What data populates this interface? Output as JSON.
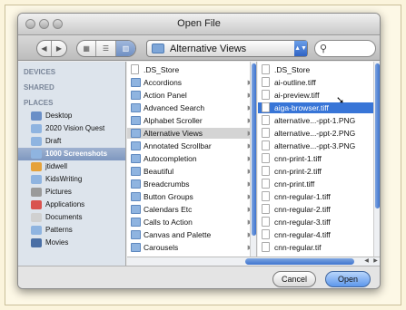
{
  "window": {
    "title": "Open File"
  },
  "toolbar": {
    "back_icon": "back-arrow-icon",
    "forward_icon": "forward-arrow-icon",
    "path_popup": "Alternative Views",
    "search_placeholder": ""
  },
  "sidebar": {
    "devices": "DEVICES",
    "shared": "SHARED",
    "places": "PLACES",
    "items": [
      {
        "label": "Desktop",
        "color": "#6a8fc7"
      },
      {
        "label": "2020 Vision Quest",
        "color": "#8fb4e0"
      },
      {
        "label": "Draft",
        "color": "#8fb4e0"
      },
      {
        "label": "1000 Screenshots",
        "color": "#8fb4e0"
      },
      {
        "label": "jtidwell",
        "color": "#e6a23a"
      },
      {
        "label": "KidsWriting",
        "color": "#8fb4e0"
      },
      {
        "label": "Pictures",
        "color": "#9a9a9a"
      },
      {
        "label": "Applications",
        "color": "#d9534f"
      },
      {
        "label": "Documents",
        "color": "#d0d0d0"
      },
      {
        "label": "Patterns",
        "color": "#8fb4e0"
      },
      {
        "label": "Movies",
        "color": "#4a6fa5"
      }
    ],
    "selected_index": 3
  },
  "column1": {
    "rows": [
      {
        "label": ".DS_Store",
        "type": "doc"
      },
      {
        "label": "Accordions",
        "type": "folder"
      },
      {
        "label": "Action Panel",
        "type": "folder"
      },
      {
        "label": "Advanced Search",
        "type": "folder"
      },
      {
        "label": "Alphabet Scroller",
        "type": "folder"
      },
      {
        "label": "Alternative Views",
        "type": "folder"
      },
      {
        "label": "Annotated Scrollbar",
        "type": "folder"
      },
      {
        "label": "Autocompletion",
        "type": "folder"
      },
      {
        "label": "Beautiful",
        "type": "folder"
      },
      {
        "label": "Breadcrumbs",
        "type": "folder"
      },
      {
        "label": "Button Groups",
        "type": "folder"
      },
      {
        "label": "Calendars Etc",
        "type": "folder"
      },
      {
        "label": "Calls to Action",
        "type": "folder"
      },
      {
        "label": "Canvas and Palette",
        "type": "folder"
      },
      {
        "label": "Carousels",
        "type": "folder"
      }
    ],
    "selected_index": 5
  },
  "column2": {
    "rows": [
      {
        "label": ".DS_Store"
      },
      {
        "label": "ai-outline.tiff"
      },
      {
        "label": "ai-preview.tiff"
      },
      {
        "label": "aiga-browser.tiff"
      },
      {
        "label": "alternative...-ppt-1.PNG"
      },
      {
        "label": "alternative...-ppt-2.PNG"
      },
      {
        "label": "alternative...-ppt-3.PNG"
      },
      {
        "label": "cnn-print-1.tiff"
      },
      {
        "label": "cnn-print-2.tiff"
      },
      {
        "label": "cnn-print.tiff"
      },
      {
        "label": "cnn-regular-1.tiff"
      },
      {
        "label": "cnn-regular-2.tiff"
      },
      {
        "label": "cnn-regular-3.tiff"
      },
      {
        "label": "cnn-regular-4.tiff"
      },
      {
        "label": "cnn-regular.tif"
      }
    ],
    "selected_index": 3
  },
  "buttons": {
    "cancel": "Cancel",
    "open": "Open"
  }
}
